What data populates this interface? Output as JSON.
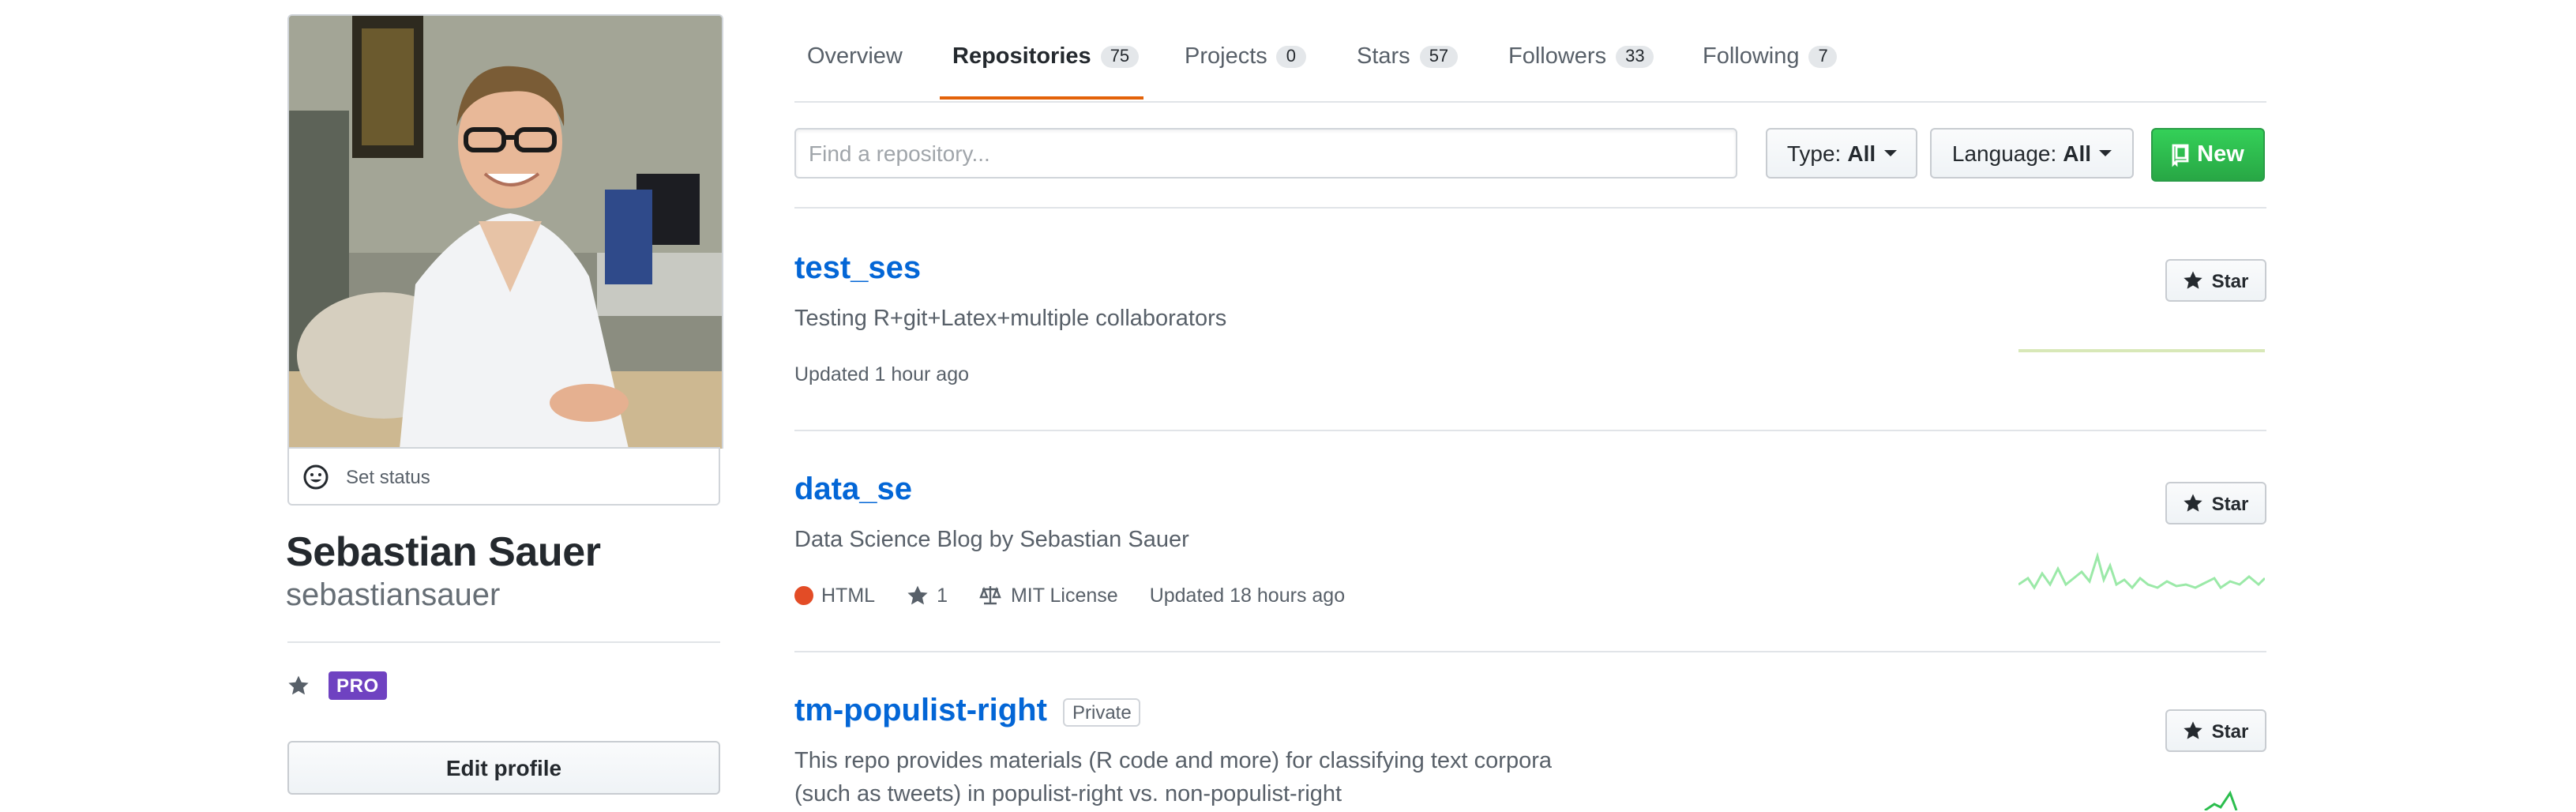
{
  "profile": {
    "set_status": "Set status",
    "full_name": "Sebastian Sauer",
    "login": "sebastiansauer",
    "pro_badge": "PRO",
    "edit_profile": "Edit profile"
  },
  "tabs": [
    {
      "label": "Overview",
      "count": null
    },
    {
      "label": "Repositories",
      "count": "75",
      "active": true
    },
    {
      "label": "Projects",
      "count": "0"
    },
    {
      "label": "Stars",
      "count": "57"
    },
    {
      "label": "Followers",
      "count": "33"
    },
    {
      "label": "Following",
      "count": "7"
    }
  ],
  "filters": {
    "search_placeholder": "Find a repository...",
    "type_label": "Type:",
    "type_value": "All",
    "language_label": "Language:",
    "language_value": "All",
    "new_label": "New"
  },
  "repos": [
    {
      "name": "test_ses",
      "description": "Testing R+git+Latex+multiple collaborators",
      "updated": "Updated 1 hour ago",
      "star_label": "Star"
    },
    {
      "name": "data_se",
      "description": "Data Science Blog by Sebastian Sauer",
      "language": "HTML",
      "stars": "1",
      "license": "MIT License",
      "updated": "Updated 18 hours ago",
      "star_label": "Star"
    },
    {
      "name": "tm-populist-right",
      "private_label": "Private",
      "description": "This repo provides materials (R code and more) for classifying text corpora (such as tweets) in populist-right vs. non-populist-right",
      "star_label": "Star"
    }
  ],
  "colors": {
    "link": "#0366d6",
    "tab_underline": "#e36209",
    "new_button": "#28a745",
    "pro_badge": "#6f42c1",
    "html_language": "#e34c26",
    "sparkline": "#9be9a8"
  }
}
